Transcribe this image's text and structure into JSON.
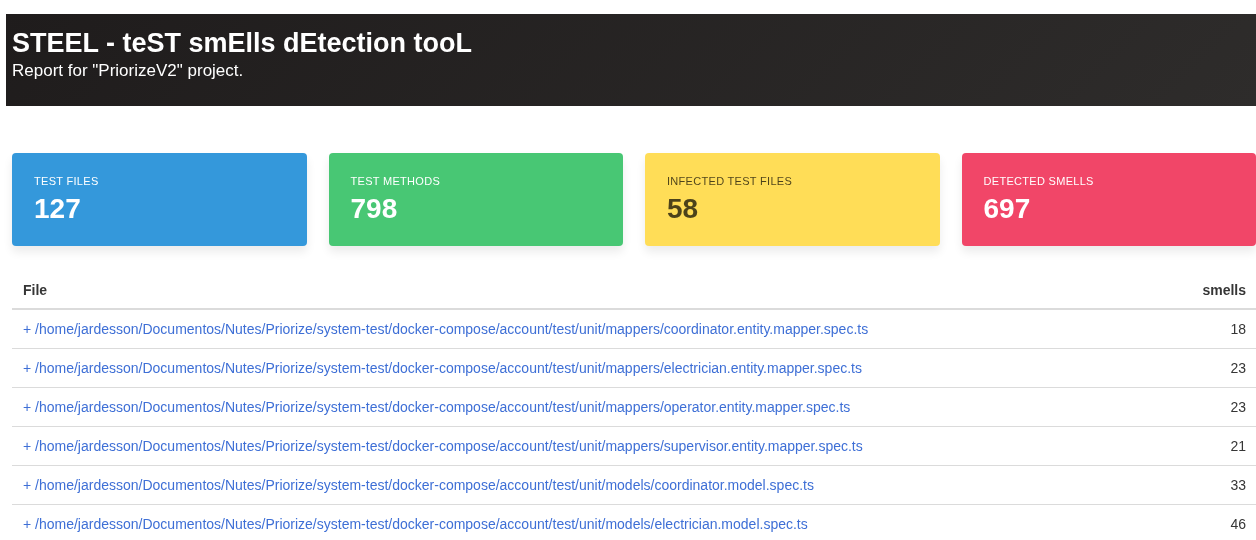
{
  "header": {
    "title": "STEEL - teST smElls dEtection tooL",
    "subtitle": "Report for \"PriorizeV2\" project."
  },
  "stats": [
    {
      "label": "TEST FILES",
      "value": "127",
      "color": "#3498db"
    },
    {
      "label": "TEST METHODS",
      "value": "798",
      "color": "#48c774"
    },
    {
      "label": "INFECTED TEST FILES",
      "value": "58",
      "color": "#ffdd57"
    },
    {
      "label": "DETECTED SMELLS",
      "value": "697",
      "color": "#f14668"
    }
  ],
  "table": {
    "columns": [
      "File",
      "smells"
    ],
    "rows": [
      {
        "toggle": "+",
        "file": "/home/jardesson/Documentos/Nutes/Priorize/system-test/docker-compose/account/test/unit/mappers/coordinator.entity.mapper.spec.ts",
        "smells": "18"
      },
      {
        "toggle": "+",
        "file": "/home/jardesson/Documentos/Nutes/Priorize/system-test/docker-compose/account/test/unit/mappers/electrician.entity.mapper.spec.ts",
        "smells": "23"
      },
      {
        "toggle": "+",
        "file": "/home/jardesson/Documentos/Nutes/Priorize/system-test/docker-compose/account/test/unit/mappers/operator.entity.mapper.spec.ts",
        "smells": "23"
      },
      {
        "toggle": "+",
        "file": "/home/jardesson/Documentos/Nutes/Priorize/system-test/docker-compose/account/test/unit/mappers/supervisor.entity.mapper.spec.ts",
        "smells": "21"
      },
      {
        "toggle": "+",
        "file": "/home/jardesson/Documentos/Nutes/Priorize/system-test/docker-compose/account/test/unit/models/coordinator.model.spec.ts",
        "smells": "33"
      },
      {
        "toggle": "+",
        "file": "/home/jardesson/Documentos/Nutes/Priorize/system-test/docker-compose/account/test/unit/models/electrician.model.spec.ts",
        "smells": "46"
      }
    ]
  }
}
